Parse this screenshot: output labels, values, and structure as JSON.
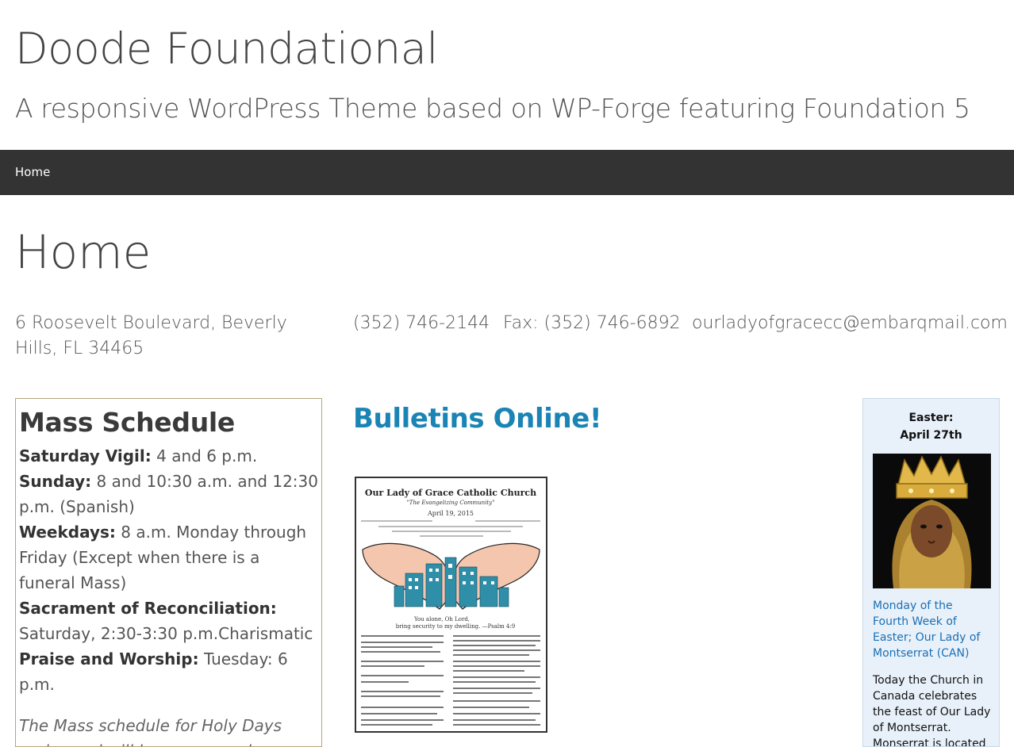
{
  "site": {
    "title": "Doode Foundational",
    "tagline": "A responsive WordPress Theme based on WP-Forge featuring Foundation 5"
  },
  "nav": {
    "items": [
      {
        "label": "Home"
      }
    ]
  },
  "page": {
    "title": "Home"
  },
  "contact": {
    "address": "6 Roosevelt Boulevard, Beverly Hills, FL 34465",
    "phone": "(352) 746-2144",
    "fax": "Fax: (352) 746-6892",
    "email": "ourladyofgracecc@embarqmail.com"
  },
  "mass_schedule": {
    "title": "Mass Schedule",
    "saturday_label": "Saturday Vigil:",
    "saturday_text": " 4 and 6 p.m.",
    "sunday_label": "Sunday:",
    "sunday_text": " 8 and 10:30 a.m. and 12:30 p.m. (Spanish)",
    "weekdays_label": "Weekdays:",
    "weekdays_text": " 8 a.m. Monday through Friday (Except when there is a funeral Mass)",
    "reconciliation_label": "Sacrament of Reconciliation:",
    "reconciliation_text": " Saturday, 2:30-3:30 p.m.Charismatic",
    "praise_label": "Praise and Worship:",
    "praise_text": " Tuesday: 6 p.m.",
    "note": "The Mass schedule for Holy Days varies and will be announced."
  },
  "bulletins": {
    "heading": "Bulletins Online!",
    "church_name": "Our Lady of Grace Catholic Church",
    "motto": "\"The Evangelizing Community\"",
    "date": "April 19, 2015",
    "verse_line1": "You alone, Oh Lord,",
    "verse_line2": "bring security to my dwelling. —Psalm 4:9"
  },
  "saint": {
    "day_label": "Easter:",
    "date": "April 27th",
    "link": "Monday of the Fourth Week of Easter; Our Lady of Montserrat (CAN)",
    "text": "Today the Church in Canada celebrates the feast of Our Lady of Montserrat. Monserrat is located in the region"
  },
  "colors": {
    "nav_bg": "#333333",
    "heading_link": "#1a84b5",
    "sidebar_bg": "#e8f1fa",
    "box_border": "#b8a47a"
  }
}
